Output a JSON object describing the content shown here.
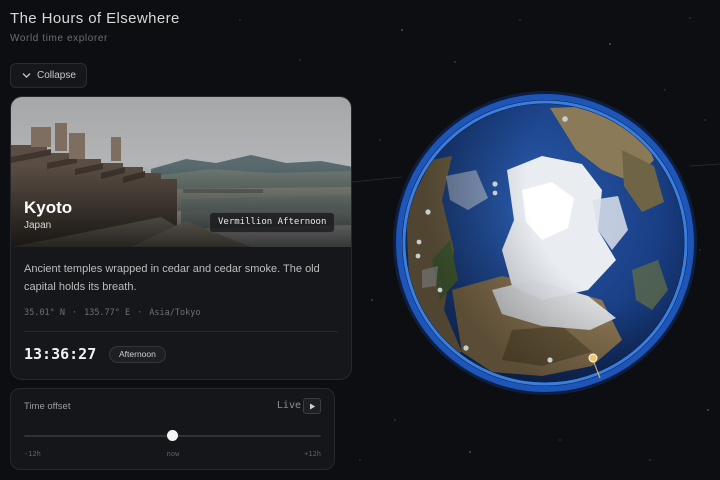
{
  "header": {
    "title": "The Hours of Elsewhere",
    "subtitle": "World time explorer"
  },
  "controls": {
    "collapse_label": "Collapse",
    "collapse_icon": "chevron-down-icon"
  },
  "city": {
    "name": "Kyoto",
    "country": "Japan",
    "vibe": "Vermillion Afternoon",
    "description": "Ancient temples wrapped in cedar and cedar smoke. The old capital holds its breath.",
    "latitude": "35.01° N",
    "longitude": "135.77° E",
    "timezone": "Asia/Tokyo",
    "local_time": "13:36:27",
    "period": "Afternoon"
  },
  "time_offset": {
    "label": "Time offset",
    "mode": "Live",
    "play_icon": "play-icon",
    "value_hours": 0,
    "min_hours": -12,
    "max_hours": 12,
    "ticks": {
      "min": "-12h",
      "mid": "now",
      "max": "+12h"
    }
  },
  "globe": {
    "rim_color": "#3a7fe0",
    "selected_marker_color": "#f3c46c"
  }
}
